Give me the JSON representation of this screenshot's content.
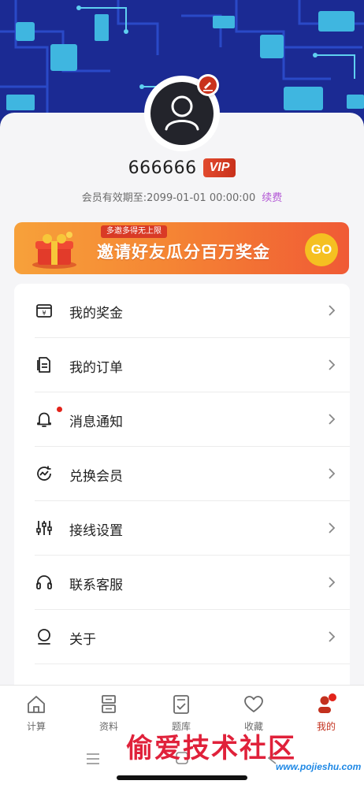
{
  "profile": {
    "username": "666666",
    "vip_badge": "VIP",
    "expiry_label": "会员有效期至:",
    "expiry_value": "2099-01-01 00:00:00",
    "renew_label": "续费"
  },
  "banner": {
    "tag": "多邀多得无上限",
    "text": "邀请好友瓜分百万奖金",
    "go": "GO"
  },
  "menu": [
    {
      "label": "我的奖金",
      "icon": "wallet-icon"
    },
    {
      "label": "我的订单",
      "icon": "order-icon"
    },
    {
      "label": "消息通知",
      "icon": "bell-icon",
      "badge_dot": true
    },
    {
      "label": "兑换会员",
      "icon": "exchange-icon"
    },
    {
      "label": "接线设置",
      "icon": "sliders-icon"
    },
    {
      "label": "联系客服",
      "icon": "headset-icon"
    },
    {
      "label": "关于",
      "icon": "about-icon"
    }
  ],
  "tabbar": [
    {
      "label": "计算",
      "icon": "home-icon",
      "active": false
    },
    {
      "label": "资料",
      "icon": "data-icon",
      "active": false
    },
    {
      "label": "题库",
      "icon": "question-bank-icon",
      "active": false
    },
    {
      "label": "收藏",
      "icon": "heart-icon",
      "active": false
    },
    {
      "label": "我的",
      "icon": "profile-icon",
      "active": true
    }
  ],
  "watermark": {
    "text": "偷爱技术社区",
    "url": "www.pojieshu.com"
  },
  "colors": {
    "accent": "#c3311e",
    "renew": "#b45ad6",
    "hero_bg": "#1c2fa0",
    "circuit": "#3fb6e0"
  }
}
